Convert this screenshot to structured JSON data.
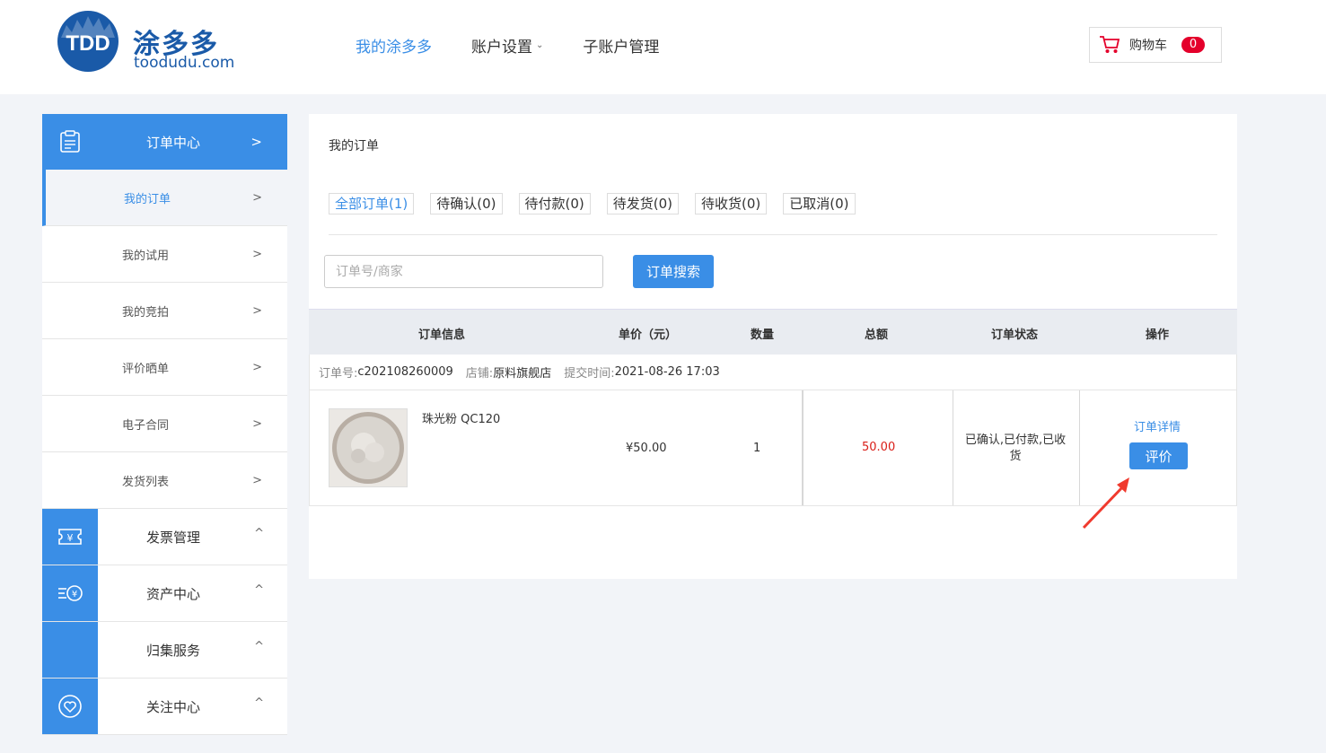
{
  "header": {
    "logo_mark": "TDD",
    "logo_cn": "涂多多",
    "logo_en": "toodudu.com",
    "nav": [
      {
        "label": "我的涂多多"
      },
      {
        "label": "账户设置"
      },
      {
        "label": "子账户管理"
      }
    ],
    "cart": {
      "label": "购物车",
      "count": "0",
      "icon": "cart-icon"
    }
  },
  "sidebar": {
    "order_center": {
      "label": "订单中心",
      "icon": "clipboard-icon"
    },
    "sub_items": [
      {
        "label": "我的订单"
      },
      {
        "label": "我的试用"
      },
      {
        "label": "我的竞拍"
      },
      {
        "label": "评价晒单"
      },
      {
        "label": "电子合同"
      },
      {
        "label": "发货列表"
      }
    ],
    "groups": [
      {
        "label": "发票管理",
        "icon": "invoice-icon"
      },
      {
        "label": "资产中心",
        "icon": "coin-icon"
      },
      {
        "label": "归集服务",
        "icon": ""
      },
      {
        "label": "关注中心",
        "icon": "heart-icon"
      }
    ]
  },
  "main": {
    "title": "我的订单",
    "tabs": [
      {
        "label": "全部订单(1)"
      },
      {
        "label": "待确认(0)"
      },
      {
        "label": "待付款(0)"
      },
      {
        "label": "待发货(0)"
      },
      {
        "label": "待收货(0)"
      },
      {
        "label": "已取消(0)"
      }
    ],
    "search": {
      "placeholder": "订单号/商家",
      "button": "订单搜索"
    },
    "table": {
      "headers": [
        "订单信息",
        "单价（元）",
        "数量",
        "总额",
        "订单状态",
        "操作"
      ],
      "order": {
        "no_label": "订单号:",
        "no": "c202108260009",
        "shop_label": "店铺:",
        "shop": "原料旗舰店",
        "time_label": "提交时间:",
        "time": "2021-08-26 17:03",
        "product": "珠光粉 QC120",
        "price": "¥50.00",
        "qty": "1",
        "total": "50.00",
        "status": "已确认,已付款,已收货",
        "detail_link": "订单详情",
        "review_button": "评价"
      }
    }
  },
  "colors": {
    "accent": "#3a8ee6",
    "price_red": "#d91e18",
    "badge_red": "#e4002b"
  }
}
